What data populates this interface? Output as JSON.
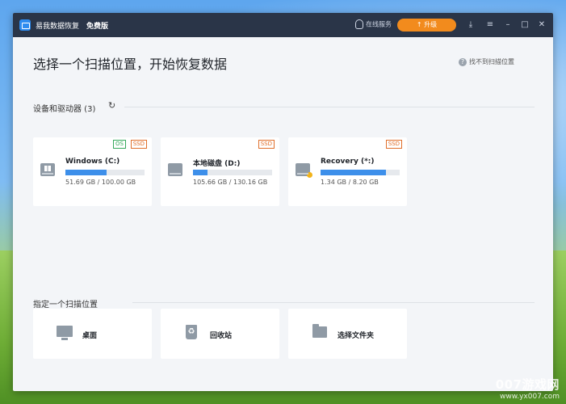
{
  "titlebar": {
    "app_title": "易我数据恢复",
    "edition": "免费版",
    "service_label": "在线服务",
    "upgrade_label": "升级"
  },
  "main": {
    "page_title": "选择一个扫描位置，开始恢复数据",
    "help_link": "找不到扫描位置",
    "devices_section": "设备和驱动器 (3)",
    "drives": [
      {
        "name": "Windows (C:)",
        "size": "51.69 GB / 100.00 GB",
        "used_fraction": 0.517,
        "tags": [
          "OS",
          "SSD"
        ]
      },
      {
        "name": "本地磁盘 (D:)",
        "size": "105.66 GB / 130.16 GB",
        "used_fraction": 0.18,
        "tags": [
          "SSD"
        ]
      },
      {
        "name": "Recovery (*:)",
        "size": "1.34 GB / 8.20 GB",
        "used_fraction": 0.83,
        "tags": [
          "SSD"
        ]
      }
    ],
    "location_section": "指定一个扫描位置",
    "locations": [
      {
        "label": "桌面",
        "icon": "desktop-icon"
      },
      {
        "label": "回收站",
        "icon": "recycle-bin-icon"
      },
      {
        "label": "选择文件夹",
        "icon": "folder-icon"
      }
    ]
  },
  "watermark": {
    "line1": "007游戏网",
    "line2": "www.yx007.com"
  },
  "colors": {
    "accent": "#3d8fea",
    "upgrade": "#f28b1d",
    "titlebar": "#2a3548",
    "os_tag": "#35a85b",
    "ssd_tag": "#e06f2b"
  }
}
